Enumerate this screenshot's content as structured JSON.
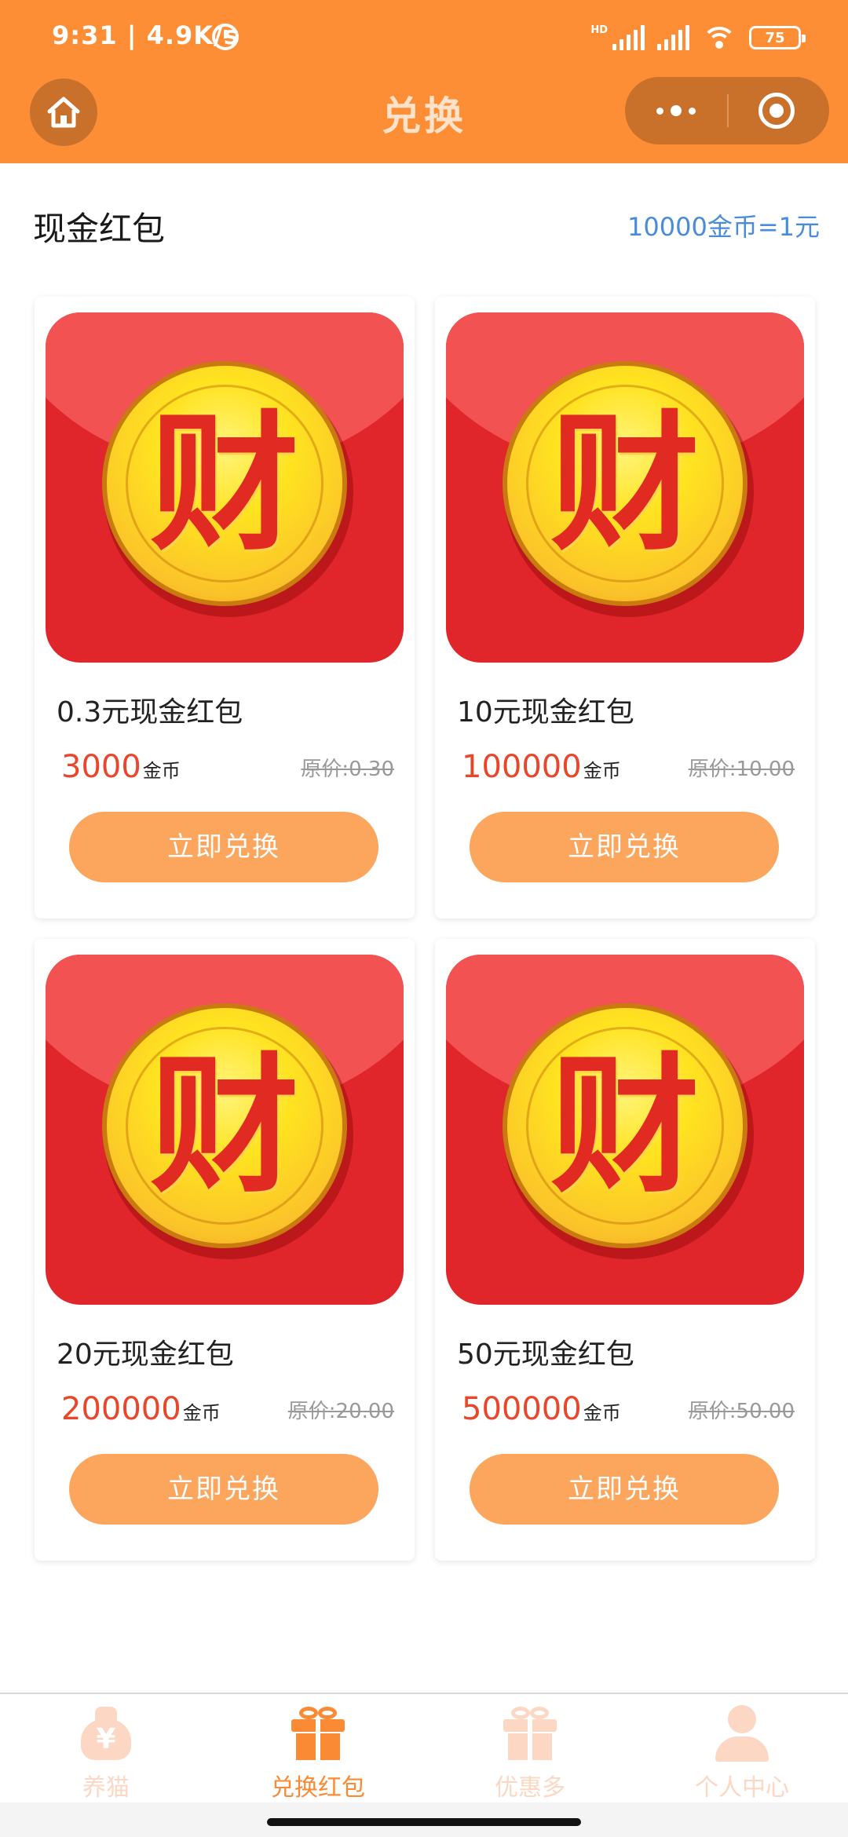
{
  "status_bar": {
    "time": "9:31 | 4.9K/s",
    "hd": "HD",
    "battery": "75"
  },
  "header": {
    "title": "兑换"
  },
  "section": {
    "title": "现金红包",
    "rate": "10000金币=1元"
  },
  "products": [
    {
      "glyph": "财",
      "name": "0.3元现金红包",
      "coins": "3000",
      "coin_unit": "金币",
      "original_price": "原价:0.30",
      "button": "立即兑换"
    },
    {
      "glyph": "财",
      "name": "10元现金红包",
      "coins": "100000",
      "coin_unit": "金币",
      "original_price": "原价:10.00",
      "button": "立即兑换"
    },
    {
      "glyph": "财",
      "name": "20元现金红包",
      "coins": "200000",
      "coin_unit": "金币",
      "original_price": "原价:20.00",
      "button": "立即兑换"
    },
    {
      "glyph": "财",
      "name": "50元现金红包",
      "coins": "500000",
      "coin_unit": "金币",
      "original_price": "原价:50.00",
      "button": "立即兑换"
    }
  ],
  "tabbar": {
    "items": [
      {
        "label": "养猫",
        "icon": "money-bag-icon",
        "symbol": "¥",
        "active": false
      },
      {
        "label": "兑换红包",
        "icon": "gift-icon",
        "active": true
      },
      {
        "label": "优惠多",
        "icon": "gift-icon",
        "active": false
      },
      {
        "label": "个人中心",
        "icon": "person-icon",
        "active": false
      }
    ]
  },
  "colors": {
    "brand": "#FD8E36",
    "button": "#FCA55D",
    "coin_price": "#E8472B",
    "rate_link": "#4A8BDA",
    "tab_active": "#FB8A34",
    "tab_inactive": "#FCD7C3"
  }
}
